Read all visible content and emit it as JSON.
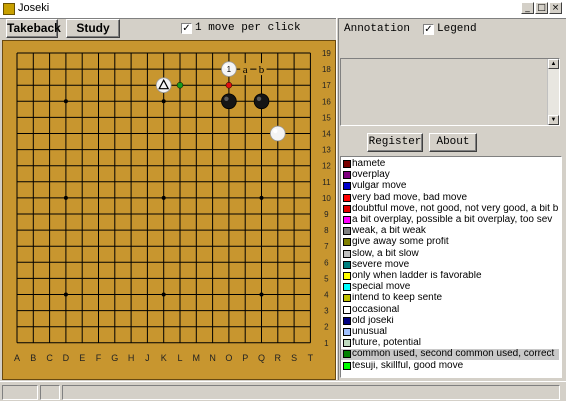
{
  "window": {
    "title": "Joseki",
    "minimize": "_",
    "maximize": "□",
    "close": "×"
  },
  "toolbar": {
    "takeback_label": "Takeback",
    "study_label": "Study",
    "one_move_label": "1 move per click",
    "one_move_checked": "✓"
  },
  "right_panel": {
    "annotation_label": "Annotation",
    "legend_label": "Legend",
    "legend_checked": "✓",
    "register_label": "Register",
    "about_label": "About"
  },
  "board": {
    "size": 19,
    "columns": [
      "A",
      "B",
      "C",
      "D",
      "E",
      "F",
      "G",
      "H",
      "J",
      "K",
      "L",
      "M",
      "N",
      "O",
      "P",
      "Q",
      "R",
      "S",
      "T"
    ],
    "rows": [
      "19",
      "18",
      "17",
      "16",
      "15",
      "14",
      "13",
      "12",
      "11",
      "10",
      "9",
      "8",
      "7",
      "6",
      "5",
      "4",
      "3",
      "2",
      "1"
    ],
    "stones": [
      {
        "color": "white",
        "point": "O18",
        "label": "1"
      },
      {
        "color": "white",
        "point": "K17",
        "marker": "triangle"
      },
      {
        "color": "black",
        "point": "O16"
      },
      {
        "color": "black",
        "point": "Q16"
      },
      {
        "color": "white",
        "point": "R14"
      }
    ],
    "marks": [
      {
        "point": "P18",
        "text": "a"
      },
      {
        "point": "Q18",
        "text": "b"
      },
      {
        "point": "L17",
        "dot": "#1a9a1a"
      },
      {
        "point": "O17",
        "dot": "#e01010"
      }
    ]
  },
  "legend": [
    {
      "color": "#7a0000",
      "label": "hamete"
    },
    {
      "color": "#800080",
      "label": "overplay"
    },
    {
      "color": "#0000cc",
      "label": "vulgar move"
    },
    {
      "color": "#ff0000",
      "label": "very bad move, bad move"
    },
    {
      "color": "#e00000",
      "label": "doubtful move, not good, not very good, a bit b"
    },
    {
      "color": "#ff00ff",
      "label": "a bit overplay, possible a bit overplay, too sev"
    },
    {
      "color": "#808080",
      "label": "weak, a bit weak"
    },
    {
      "color": "#808000",
      "label": "give away some profit"
    },
    {
      "color": "#c0c0c0",
      "label": "slow, a bit slow"
    },
    {
      "color": "#008080",
      "label": "severe move"
    },
    {
      "color": "#ffff00",
      "label": "only when ladder is favorable"
    },
    {
      "color": "#00ffff",
      "label": "special move"
    },
    {
      "color": "#c0c000",
      "label": "intend to keep sente"
    },
    {
      "color": "#ffffff",
      "label": "occasional"
    },
    {
      "color": "#000080",
      "label": "old joseki"
    },
    {
      "color": "#a0c0ff",
      "label": "unusual"
    },
    {
      "color": "#c0dcc0",
      "label": "future, potential"
    },
    {
      "color": "#008000",
      "label": "common used, second common used, correct",
      "selected": true
    },
    {
      "color": "#00ff00",
      "label": "tesuji, skillful, good move"
    }
  ]
}
